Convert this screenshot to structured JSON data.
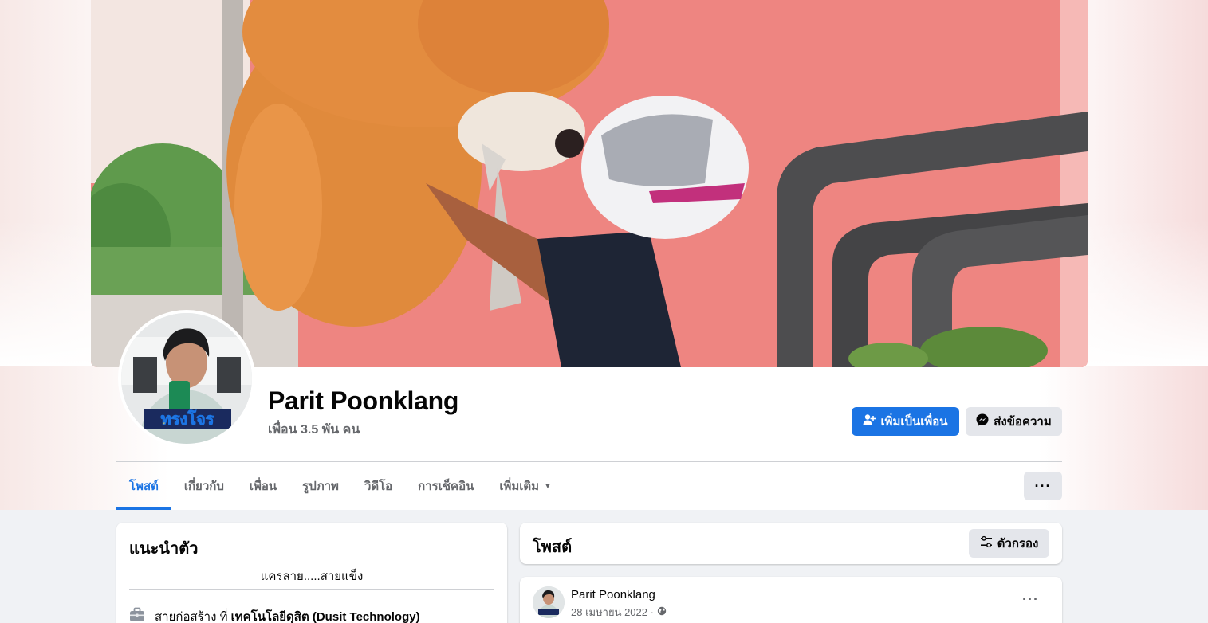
{
  "profile": {
    "name": "Parit Poonklang",
    "friends_count": "เพื่อน 3.5 พัน คน"
  },
  "actions": {
    "add_friend_label": "เพิ่มเป็นเพื่อน",
    "message_label": "ส่งข้อความ",
    "more_label": "···"
  },
  "tabs": [
    {
      "label": "โพสต์",
      "active": true
    },
    {
      "label": "เกี่ยวกับ"
    },
    {
      "label": "เพื่อน"
    },
    {
      "label": "รูปภาพ"
    },
    {
      "label": "วิดีโอ"
    },
    {
      "label": "การเช็คอิน"
    },
    {
      "label": "เพิ่มเติม"
    }
  ],
  "intro": {
    "title": "แนะนำตัว",
    "bio": "แครลาย.....สายแข็ง",
    "work_prefix": "สายก่อสร้าง ที่",
    "work_company": "เทคโนโลยีดุสิต (Dusit Technology)"
  },
  "posts_section": {
    "title": "โพสต์",
    "filter_label": "ตัวกรอง"
  },
  "post": {
    "author": "Parit Poonklang",
    "date": "28 เมษายน 2022 ·",
    "more_label": "···"
  },
  "avatar_overlay_text": "ทรงโจร",
  "colors": {
    "accent": "#1b74e4",
    "secondary_button": "#e4e6eb",
    "muted_text": "#65676b",
    "page_bg": "#f0f2f5"
  }
}
